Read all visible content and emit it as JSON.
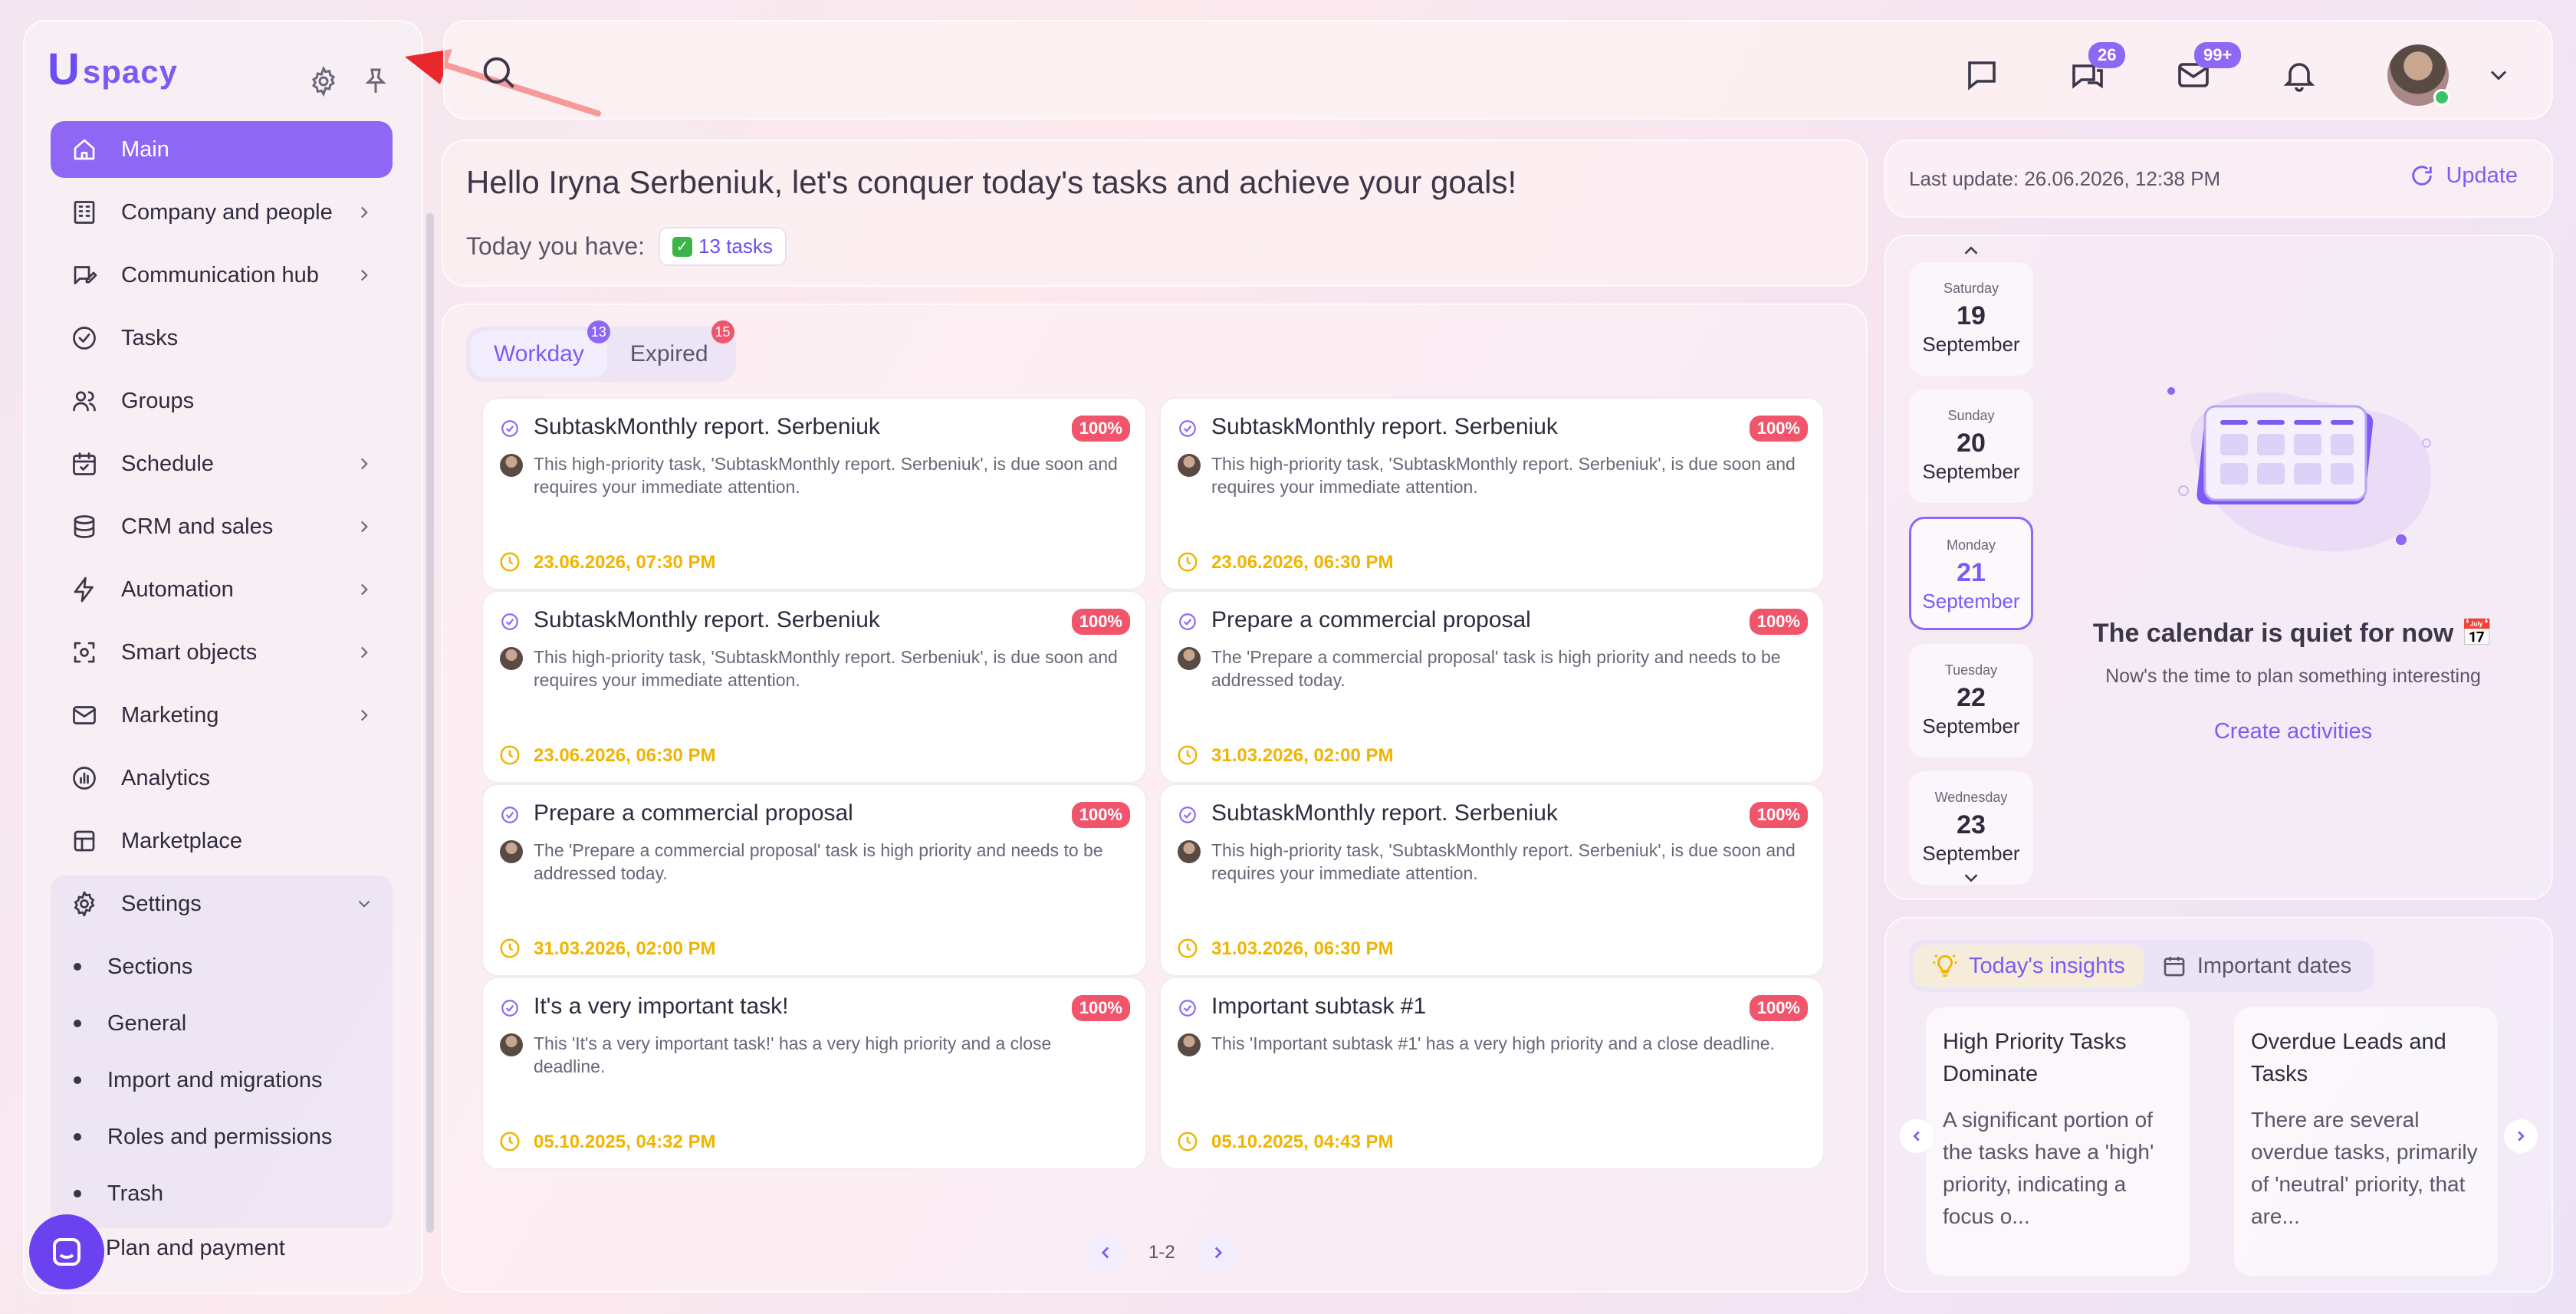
{
  "app": {
    "logo_mark": "U",
    "logo_text": "spacy"
  },
  "sidebar": {
    "items": [
      {
        "label": "Main",
        "icon": "home-icon",
        "active": true,
        "chevron": false
      },
      {
        "label": "Company and people",
        "icon": "building-icon",
        "chevron": true
      },
      {
        "label": "Communication hub",
        "icon": "chat-edit-icon",
        "chevron": true
      },
      {
        "label": "Tasks",
        "icon": "check-circle-icon",
        "chevron": false
      },
      {
        "label": "Groups",
        "icon": "users-icon",
        "chevron": false
      },
      {
        "label": "Schedule",
        "icon": "calendar-icon",
        "chevron": true
      },
      {
        "label": "CRM and sales",
        "icon": "database-icon",
        "chevron": true
      },
      {
        "label": "Automation",
        "icon": "bolt-icon",
        "chevron": true
      },
      {
        "label": "Smart objects",
        "icon": "smart-object-icon",
        "chevron": true
      },
      {
        "label": "Marketing",
        "icon": "mail-icon",
        "chevron": true
      },
      {
        "label": "Analytics",
        "icon": "chart-icon",
        "chevron": false
      },
      {
        "label": "Marketplace",
        "icon": "store-icon",
        "chevron": false
      }
    ],
    "settings": {
      "label": "Settings",
      "sub_items": [
        "Sections",
        "General",
        "Import and migrations",
        "Roles and permissions",
        "Trash"
      ]
    },
    "plan": "Plan and payment"
  },
  "header": {
    "badges": {
      "chats": "26",
      "mail": "99+"
    }
  },
  "greeting": {
    "title": "Hello Iryna Serbeniuk, let's conquer today's tasks and achieve your goals!",
    "today_label": "Today you have:",
    "tasks_count": "13 tasks"
  },
  "tasks": {
    "tabs": [
      {
        "label": "Workday",
        "badge": "13",
        "active": true
      },
      {
        "label": "Expired",
        "badge": "15",
        "active": false
      }
    ],
    "cards": [
      {
        "title": "SubtaskMonthly report. Serbeniuk",
        "pct": "100%",
        "desc": "This high-priority task, 'SubtaskMonthly report. Serbeniuk', is due soon and requires your immediate attention.",
        "due": "23.06.2026, 07:30 PM"
      },
      {
        "title": "SubtaskMonthly report. Serbeniuk",
        "pct": "100%",
        "desc": "This high-priority task, 'SubtaskMonthly report. Serbeniuk', is due soon and requires your immediate attention.",
        "due": "23.06.2026, 06:30 PM"
      },
      {
        "title": "SubtaskMonthly report. Serbeniuk",
        "pct": "100%",
        "desc": "This high-priority task, 'SubtaskMonthly report. Serbeniuk', is due soon and requires your immediate attention.",
        "due": "23.06.2026, 06:30 PM"
      },
      {
        "title": "Prepare a commercial proposal",
        "pct": "100%",
        "desc": "The 'Prepare a commercial proposal' task is high priority and needs to be addressed today.",
        "due": "31.03.2026, 02:00 PM"
      },
      {
        "title": "Prepare a commercial proposal",
        "pct": "100%",
        "desc": "The 'Prepare a commercial proposal' task is high priority and needs to be addressed today.",
        "due": "31.03.2026, 02:00 PM"
      },
      {
        "title": "SubtaskMonthly report. Serbeniuk",
        "pct": "100%",
        "desc": "This high-priority task, 'SubtaskMonthly report. Serbeniuk', is due soon and requires your immediate attention.",
        "due": "31.03.2026, 06:30 PM"
      },
      {
        "title": "It's a very important task!",
        "pct": "100%",
        "desc": "This 'It's a very important task!' has a very high priority and a close deadline.",
        "due": "05.10.2025, 04:32 PM"
      },
      {
        "title": "Important subtask #1",
        "pct": "100%",
        "desc": "This 'Important subtask #1' has a very high priority and a close deadline.",
        "due": "05.10.2025, 04:43 PM"
      }
    ],
    "pager": "1-2"
  },
  "update": {
    "last": "Last update: 26.06.2026, 12:38 PM",
    "button": "Update"
  },
  "calendar": {
    "days": [
      {
        "weekday": "Saturday",
        "day": "19",
        "month": "September",
        "selected": false
      },
      {
        "weekday": "Sunday",
        "day": "20",
        "month": "September",
        "selected": false
      },
      {
        "weekday": "Monday",
        "day": "21",
        "month": "September",
        "selected": true
      },
      {
        "weekday": "Tuesday",
        "day": "22",
        "month": "September",
        "selected": false
      },
      {
        "weekday": "Wednesday",
        "day": "23",
        "month": "September",
        "selected": false
      }
    ],
    "quiet": "The calendar is quiet for now 📅",
    "sub": "Now's the time to plan something interesting",
    "create": "Create activities"
  },
  "insights": {
    "tabs": [
      {
        "label": "Today's insights",
        "icon": "bulb-icon",
        "active": true
      },
      {
        "label": "Important dates",
        "icon": "calendar-icon",
        "active": false
      }
    ],
    "cards": [
      {
        "title": "High Priority Tasks Dominate",
        "text": "A significant portion of the tasks have a 'high' priority, indicating a focus o..."
      },
      {
        "title": "Overdue Leads and Tasks",
        "text": "There are several overdue tasks, primarily of 'neutral' priority, that are..."
      }
    ]
  },
  "colors": {
    "accent": "#8e67f5",
    "danger": "#f0556b",
    "due": "#f0b400"
  }
}
